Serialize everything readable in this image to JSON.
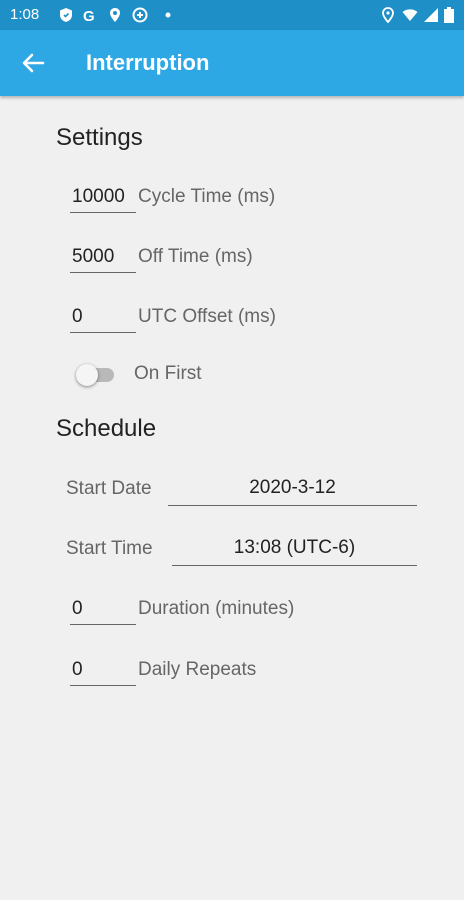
{
  "status_bar": {
    "time": "1:08",
    "left_icons": [
      "shield-icon",
      "google-icon",
      "location-icon",
      "data-saver-icon",
      "dot-icon"
    ],
    "right_icons": [
      "location-icon",
      "wifi-icon",
      "signal-icon",
      "battery-icon"
    ]
  },
  "app_bar": {
    "title": "Interruption",
    "back_icon": "arrow-left-icon",
    "color": "#2ea8e5"
  },
  "settings": {
    "title": "Settings",
    "cycle_time": {
      "value": "10000",
      "label": "Cycle Time (ms)"
    },
    "off_time": {
      "value": "5000",
      "label": "Off Time (ms)"
    },
    "utc_offset": {
      "value": "0",
      "label": "UTC Offset (ms)"
    },
    "on_first": {
      "label": "On First",
      "checked": false
    }
  },
  "schedule": {
    "title": "Schedule",
    "start_date": {
      "label": "Start Date",
      "value": "2020-3-12"
    },
    "start_time": {
      "label": "Start Time",
      "value": "13:08 (UTC-6)"
    },
    "duration": {
      "value": "0",
      "label": "Duration (minutes)"
    },
    "daily_repeats": {
      "value": "0",
      "label": "Daily Repeats"
    }
  }
}
